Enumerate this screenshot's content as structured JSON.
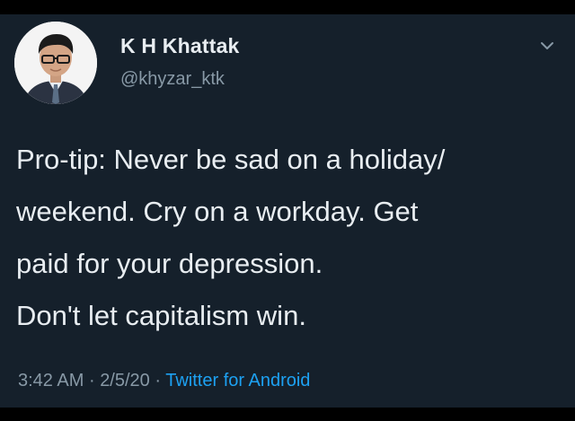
{
  "user": {
    "display_name": "K H Khattak",
    "handle": "@khyzar_ktk"
  },
  "tweet": {
    "lines": [
      "Pro-tip: Never be sad on a holiday/",
      "weekend. Cry on a workday. Get",
      "paid for your depression.",
      "Don't let capitalism win."
    ],
    "time": "3:42 AM",
    "date": "2/5/20",
    "separator": "·",
    "source": "Twitter for Android"
  },
  "icons": {
    "menu": "chevron-down-icon"
  },
  "colors": {
    "background": "#15202b",
    "text": "#e8edf1",
    "secondary": "#8899a6",
    "link": "#1da1f2"
  }
}
